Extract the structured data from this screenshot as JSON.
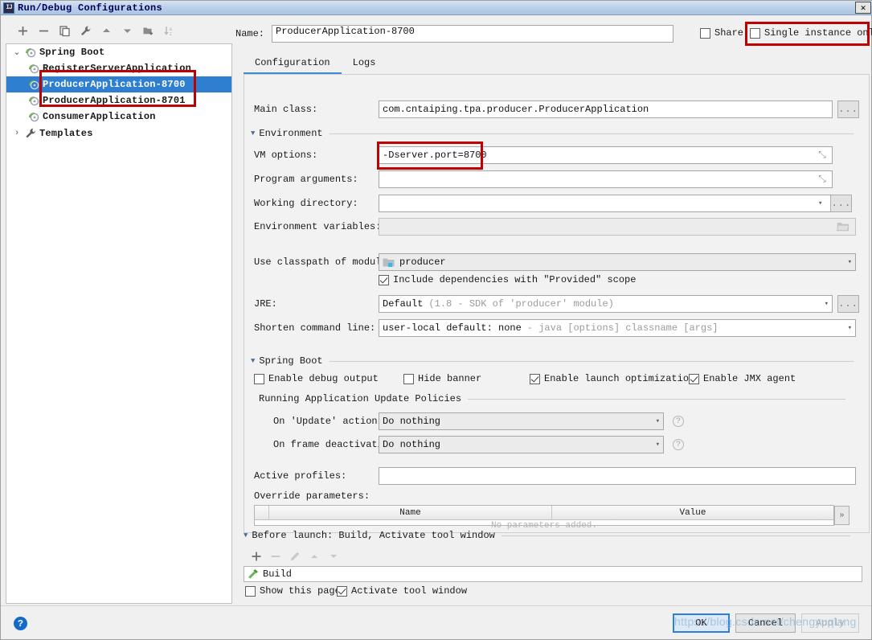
{
  "window": {
    "title": "Run/Debug Configurations",
    "icon": "intellij-idea-icon",
    "close_label": "✕"
  },
  "sidebar": {
    "toolbar": [
      {
        "name": "add-configuration-button",
        "icon": "plus-icon",
        "label": "+"
      },
      {
        "name": "remove-configuration-button",
        "icon": "minus-icon",
        "label": "−"
      },
      {
        "name": "copy-configuration-button",
        "icon": "copy-icon",
        "label": "copy"
      },
      {
        "name": "edit-templates-button",
        "icon": "wrench-icon",
        "label": "wrench"
      },
      {
        "name": "move-up-button",
        "icon": "triangle-up-icon",
        "label": "▲"
      },
      {
        "name": "move-down-button",
        "icon": "triangle-down-icon",
        "label": "▼"
      },
      {
        "name": "move-into-folder-button",
        "icon": "folder-add-icon",
        "label": "folder"
      },
      {
        "name": "sort-configurations-button",
        "icon": "sort-az-icon",
        "label": "sort"
      }
    ],
    "tree": [
      {
        "label": "Spring Boot",
        "icon": "spring-boot-icon",
        "twisty": "⌄",
        "depth": 0,
        "selected": false,
        "type": "group"
      },
      {
        "label": "RegisterServerApplication",
        "icon": "spring-boot-icon",
        "twisty": "",
        "depth": 1,
        "selected": false,
        "type": "leaf"
      },
      {
        "label": "ProducerApplication-8700",
        "icon": "spring-boot-icon",
        "twisty": "",
        "depth": 1,
        "selected": true,
        "type": "leaf"
      },
      {
        "label": "ProducerApplication-8701",
        "icon": "spring-boot-icon",
        "twisty": "",
        "depth": 1,
        "selected": false,
        "type": "leaf"
      },
      {
        "label": "ConsumerApplication",
        "icon": "spring-boot-icon",
        "twisty": "",
        "depth": 1,
        "selected": false,
        "type": "leaf"
      },
      {
        "label": "Templates",
        "icon": "wrench-icon",
        "twisty": "›",
        "depth": 0,
        "selected": false,
        "type": "group"
      }
    ]
  },
  "header": {
    "name_label": "Name:",
    "name_value": "ProducerApplication-8700",
    "share": {
      "label": "Share",
      "checked": false
    },
    "single_instance": {
      "label": "Single instance only",
      "checked": false
    }
  },
  "tabs": [
    {
      "label": "Configuration",
      "active": true
    },
    {
      "label": "Logs",
      "active": false
    }
  ],
  "configuration": {
    "main_class": {
      "label": "Main class:",
      "value": "com.cntaiping.tpa.producer.ProducerApplication",
      "browse_label": "..."
    },
    "environment": {
      "section_title": "Environment",
      "vm_options": {
        "label": "VM options:",
        "value": "-Dserver.port=8700",
        "expand_label": "⤡"
      },
      "program_arguments": {
        "label": "Program arguments:",
        "value": "",
        "expand_label": "⤡"
      },
      "working_directory": {
        "label": "Working directory:",
        "value": "",
        "browse_label": "..."
      },
      "environment_variables": {
        "label": "Environment variables:",
        "value": "",
        "browse_icon": "folder-icon"
      }
    },
    "classpath": {
      "label": "Use classpath of module:",
      "value": "producer",
      "module_icon": "module-icon"
    },
    "include_provided": {
      "label": "Include dependencies with \"Provided\" scope",
      "checked": true
    },
    "jre": {
      "label": "JRE:",
      "value": "Default",
      "hint": "(1.8 - SDK of 'producer' module)",
      "browse_label": "..."
    },
    "shorten_cmd": {
      "label": "Shorten command line:",
      "value": "user-local default: none",
      "hint": "- java [options] classname [args]"
    },
    "spring_boot": {
      "section_title": "Spring Boot",
      "checkboxes": [
        {
          "label": "Enable debug output",
          "checked": false,
          "name": "enable-debug-output-checkbox"
        },
        {
          "label": "Hide banner",
          "checked": false,
          "name": "hide-banner-checkbox"
        },
        {
          "label": "Enable launch optimization",
          "checked": true,
          "name": "enable-launch-optimization-checkbox"
        },
        {
          "label": "Enable JMX agent",
          "checked": true,
          "name": "enable-jmx-agent-checkbox"
        }
      ],
      "update_policies": {
        "section_title": "Running Application Update Policies",
        "on_update": {
          "label": "On 'Update' action:",
          "value": "Do nothing",
          "help": "?"
        },
        "on_frame_deactivation": {
          "label": "On frame deactivation:",
          "value": "Do nothing",
          "help": "?"
        }
      },
      "active_profiles": {
        "label": "Active profiles:",
        "value": ""
      },
      "override_parameters": {
        "label": "Override parameters:",
        "columns": [
          "Name",
          "Value"
        ],
        "empty_text": "No parameters added.",
        "more_label": "»"
      }
    }
  },
  "before_launch": {
    "section_title": "Before launch: Build, Activate tool window",
    "toolbar": [
      {
        "name": "add-task-button",
        "icon": "plus-icon",
        "label": "+",
        "enabled": true
      },
      {
        "name": "remove-task-button",
        "icon": "minus-icon",
        "label": "−",
        "enabled": false
      },
      {
        "name": "edit-task-button",
        "icon": "pencil-icon",
        "label": "edit",
        "enabled": false
      },
      {
        "name": "task-move-up-button",
        "icon": "triangle-up-icon",
        "label": "▲",
        "enabled": false
      },
      {
        "name": "task-move-down-button",
        "icon": "triangle-down-icon",
        "label": "▼",
        "enabled": false
      }
    ],
    "tasks": [
      {
        "label": "Build",
        "icon": "hammer-icon"
      }
    ],
    "show_this_page": {
      "label": "Show this page",
      "checked": false
    },
    "activate_tool_window": {
      "label": "Activate tool window",
      "checked": true
    }
  },
  "footer": {
    "help": "?",
    "ok": "OK",
    "cancel": "Cancel",
    "apply": "Apply"
  },
  "watermark": "https://blog.csdn.net/chengyuqiang",
  "colors": {
    "selection": "#2f7fd1",
    "accent": "#3f8cd4",
    "annotation": "#c00000",
    "titlebar_text": "#00005a"
  }
}
